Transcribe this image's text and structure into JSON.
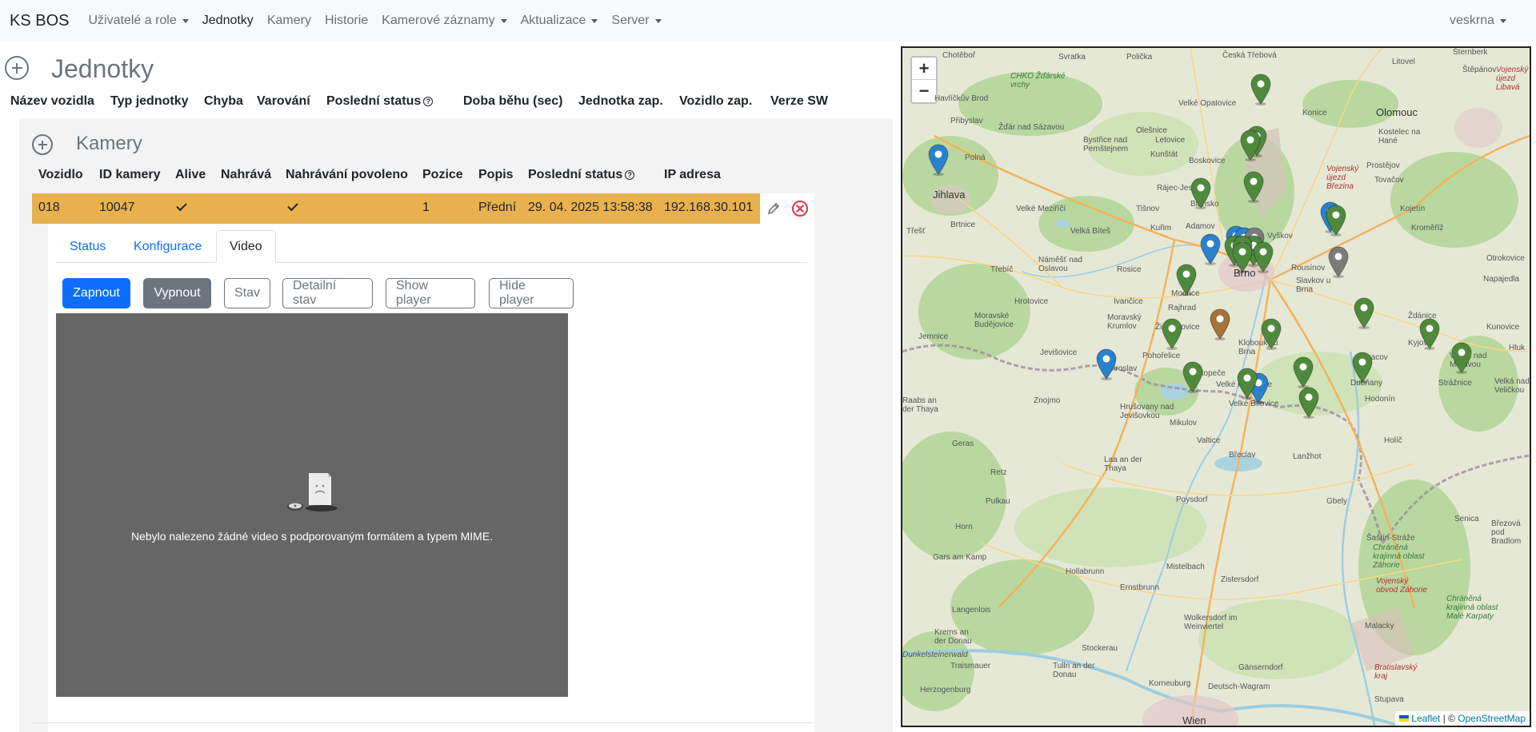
{
  "navbar": {
    "brand": "KS BOS",
    "items": [
      {
        "label": "Uživatelé a role",
        "dropdown": true
      },
      {
        "label": "Jednotky",
        "dropdown": false,
        "active": true
      },
      {
        "label": "Kamery",
        "dropdown": false
      },
      {
        "label": "Historie",
        "dropdown": false
      },
      {
        "label": "Kamerové záznamy",
        "dropdown": true
      },
      {
        "label": "Aktualizace",
        "dropdown": true
      },
      {
        "label": "Server",
        "dropdown": true
      }
    ],
    "user": "veskrna"
  },
  "units": {
    "title": "Jednotky",
    "columns": [
      "Název vozidla",
      "Typ jednotky",
      "Chyba",
      "Varování",
      "Poslední status",
      "Doba běhu (sec)",
      "Jednotka zap.",
      "Vozidlo zap.",
      "Verze SW"
    ]
  },
  "cameras": {
    "title": "Kamery",
    "columns": [
      "Vozidlo",
      "ID kamery",
      "Alive",
      "Nahrává",
      "Nahrávání povoleno",
      "Pozice",
      "Popis",
      "Poslední status",
      "IP adresa"
    ],
    "row": {
      "vehicle": "018",
      "camera_id": "10047",
      "alive": true,
      "recording": false,
      "recording_allowed": true,
      "position": "1",
      "description": "Přední",
      "last_status": "29. 04. 2025 13:58:38",
      "ip": "192.168.30.101",
      "highlight_color": "#e9b04f"
    }
  },
  "detail": {
    "tabs": [
      {
        "label": "Status",
        "active": false
      },
      {
        "label": "Konfigurace",
        "active": false
      },
      {
        "label": "Video",
        "active": true
      }
    ],
    "buttons": {
      "on": "Zapnout",
      "off": "Vypnout",
      "state": "Stav",
      "detail_state": "Detailní stav",
      "show_player": "Show player",
      "hide_player": "Hide player"
    },
    "video_message": "Nebylo nalezeno žádné video s podporovaným formátem a typem MIME."
  },
  "map": {
    "zoom_in": "+",
    "zoom_out": "−",
    "attribution": {
      "leaflet": "Leaflet",
      "separator": " | © ",
      "osm": "OpenStreetMap"
    },
    "places": [
      "Chotěboř",
      "Svratka",
      "Polička",
      "Česká Třebová",
      "Litovel",
      "Šternberk",
      "Štěpánov",
      "Havlíčkův Brod",
      "Přibyslav",
      "CHKO Žďárské vrchy",
      "Žďár nad Sázavou",
      "Olešnice",
      "Velké Opatovice",
      "Konice",
      "Olomouc",
      "Polná",
      "Bystřice nad Pernštejnem",
      "Letovice",
      "Kunštát",
      "Boskovice",
      "Kostelec na Hané",
      "Prostějov",
      "Jihlava",
      "Velké Meziříčí",
      "Rájec-Jestřebí",
      "Blansko",
      "Tovačov",
      "Tišnov",
      "Kojetín",
      "Brtnice",
      "Velká Bíteš",
      "Kuřim",
      "Adamov",
      "Vyškov",
      "Kroměříž",
      "Třešť",
      "Náměšť nad Oslavou",
      "Třebíč",
      "Rosice",
      "Brno",
      "Rousínov",
      "Slavkov u Brna",
      "Otrokovice",
      "Napajedla",
      "Hrotovice",
      "Ivančice",
      "Modřice",
      "Rajhrad",
      "Moravské Budějovice",
      "Moravský Krumlov",
      "Židlochovice",
      "Ždánice",
      "Kunovice",
      "Jemnice",
      "Jevišovice",
      "Miroslav",
      "Pohořelice",
      "Klobouky u Brna",
      "Hustopeče",
      "Kyjov",
      "Veselí nad Moravou",
      "Hluk",
      "Velká nad Veličkou",
      "Vracov",
      "Strážnice",
      "Velké Pavlovice",
      "Velké Bílovice",
      "Dubňany",
      "Hodonín",
      "Raabs an der Thaya",
      "Znojmo",
      "Hrušovany nad Jevišovkou",
      "Mikulov",
      "Valtice",
      "Břeclav",
      "Holíč",
      "Geras",
      "Lanžhot",
      "Retz",
      "Laa an der Thaya",
      "Poysdorf",
      "Gbely",
      "Pulkau",
      "Horn",
      "Senica",
      "Březová pod Bradlom",
      "Gars am Kamp",
      "Hollabrunn",
      "Mistelbach",
      "Šaštín-Stráže",
      "Zistersdorf",
      "Ernstbrunn",
      "Chráněná krajinná oblast Záhorie",
      "Vojenský obvod Záhorie",
      "Langenlois",
      "Krems an der Donau",
      "Stockerau",
      "Wolkersdorf im Weinviertel",
      "Malacky",
      "Chráněná krajinná oblast Malé Karpaty",
      "Traismauer",
      "Tulln an der Donau",
      "Gänserndorf",
      "Korneuburg",
      "Deutsch-Wagram",
      "Herzogenburg",
      "Bratislavský kraj",
      "Stupava",
      "Wien",
      "Vojenský újezd Libavá",
      "Vojenský újezd Březina",
      "Dunkelsteinerwald"
    ],
    "markers": [
      {
        "color": "green"
      },
      {
        "color": "green"
      },
      {
        "color": "green"
      },
      {
        "color": "blue"
      },
      {
        "color": "green"
      },
      {
        "color": "green"
      },
      {
        "color": "blue"
      },
      {
        "color": "green"
      },
      {
        "color": "blue"
      },
      {
        "color": "blue"
      },
      {
        "color": "grey"
      },
      {
        "color": "green"
      },
      {
        "color": "green"
      },
      {
        "color": "blue"
      },
      {
        "color": "green"
      },
      {
        "color": "grey"
      },
      {
        "color": "green"
      },
      {
        "color": "green"
      },
      {
        "color": "brown"
      },
      {
        "color": "green"
      },
      {
        "color": "green"
      },
      {
        "color": "green"
      },
      {
        "color": "blue"
      },
      {
        "color": "green"
      },
      {
        "color": "green"
      },
      {
        "color": "green"
      },
      {
        "color": "green"
      },
      {
        "color": "blue"
      },
      {
        "color": "green"
      },
      {
        "color": "green"
      },
      {
        "color": "green"
      },
      {
        "color": "green"
      }
    ]
  }
}
